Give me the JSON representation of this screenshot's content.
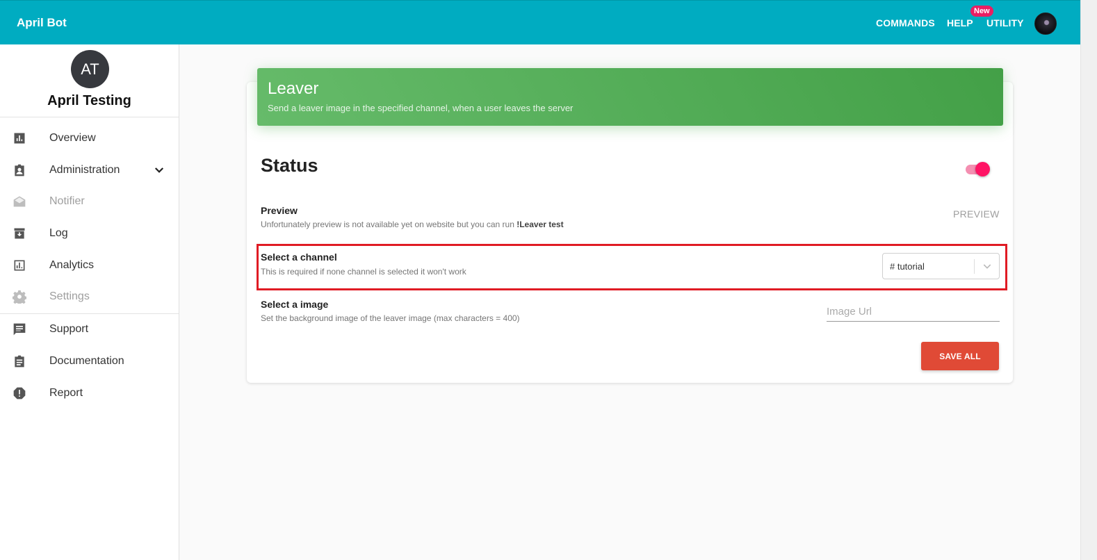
{
  "header": {
    "brand": "April Bot",
    "nav": {
      "commands": "COMMANDS",
      "help": "HELP",
      "utility": "UTILITY",
      "badge": "New"
    }
  },
  "sidebar": {
    "guild_initials": "AT",
    "guild_name": "April Testing",
    "items": [
      {
        "label": "Overview",
        "icon": "bar-chart-icon"
      },
      {
        "label": "Administration",
        "icon": "badge-icon"
      },
      {
        "label": "Notifier",
        "icon": "mail-open-icon"
      },
      {
        "label": "Log",
        "icon": "archive-icon"
      },
      {
        "label": "Analytics",
        "icon": "analytics-icon"
      },
      {
        "label": "Settings",
        "icon": "gear-icon"
      },
      {
        "label": "Support",
        "icon": "chat-icon"
      },
      {
        "label": "Documentation",
        "icon": "clipboard-icon"
      },
      {
        "label": "Report",
        "icon": "alert-octagon-icon"
      }
    ]
  },
  "card": {
    "title": "Leaver",
    "subtitle": "Send a leaver image in the specified channel, when a user leaves the server",
    "status_title": "Status",
    "status_enabled": true,
    "preview": {
      "title": "Preview",
      "desc": "Unfortunately preview is not available yet on website but you can run",
      "command": "!Leaver test",
      "button": "PREVIEW"
    },
    "channel": {
      "title": "Select a channel",
      "desc": "This is required if none channel is selected it won't work",
      "value": "# tutorial"
    },
    "image": {
      "title": "Select a image",
      "desc": "Set the background image of the leaver image (max characters = 400)",
      "placeholder": "Image Url"
    },
    "save": "SAVE ALL"
  },
  "colors": {
    "topbar": "#00acc1",
    "header_green": "#4caf50",
    "toggle_pink": "#ff1465",
    "save_red": "#e04a36",
    "highlight": "#e01b24"
  }
}
